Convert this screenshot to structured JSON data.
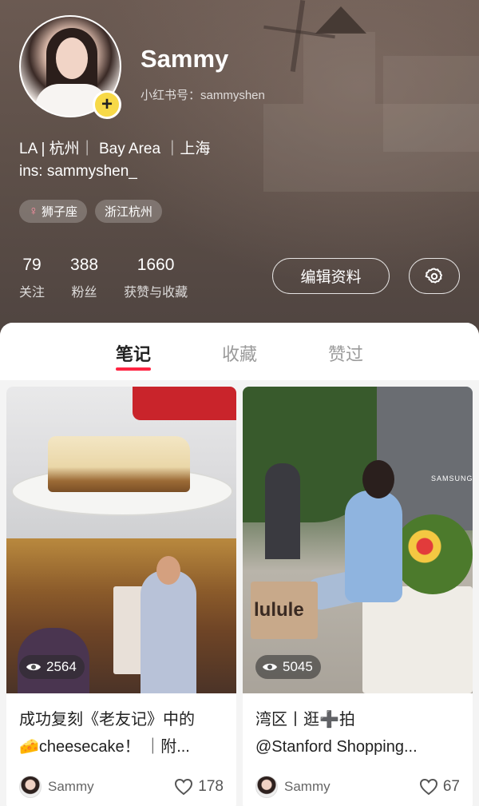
{
  "profile": {
    "name": "Sammy",
    "red_id": "小红书号：sammyshen",
    "bio_line1": "LA | 杭州｜ Bay Area ｜上海",
    "bio_line2": "ins: sammyshen_",
    "tags": [
      {
        "icon": "female-icon",
        "label": "狮子座"
      },
      {
        "label": "浙江杭州"
      }
    ],
    "stats": [
      {
        "value": "79",
        "label": "关注"
      },
      {
        "value": "388",
        "label": "粉丝"
      },
      {
        "value": "1660",
        "label": "获赞与收藏"
      }
    ],
    "edit_label": "编辑资料"
  },
  "tabs": [
    {
      "label": "笔记",
      "active": true
    },
    {
      "label": "收藏",
      "active": false
    },
    {
      "label": "赞过",
      "active": false
    }
  ],
  "notes": [
    {
      "views": "2564",
      "title_line1": "成功复刻《老友记》中的",
      "title_line2": "🧀cheesecake！ ｜附...",
      "author": "Sammy",
      "likes": "178"
    },
    {
      "views": "5045",
      "title_line1": "湾区丨逛➕拍",
      "title_line2": "@Stanford Shopping...",
      "author": "Sammy",
      "likes": "67",
      "bag_text": "lulule",
      "store_sign": "SAMSUNG"
    }
  ],
  "colors": {
    "accent_red": "#ff2442",
    "plus_yellow": "#f7d948",
    "header_brown": "#5e5049"
  }
}
